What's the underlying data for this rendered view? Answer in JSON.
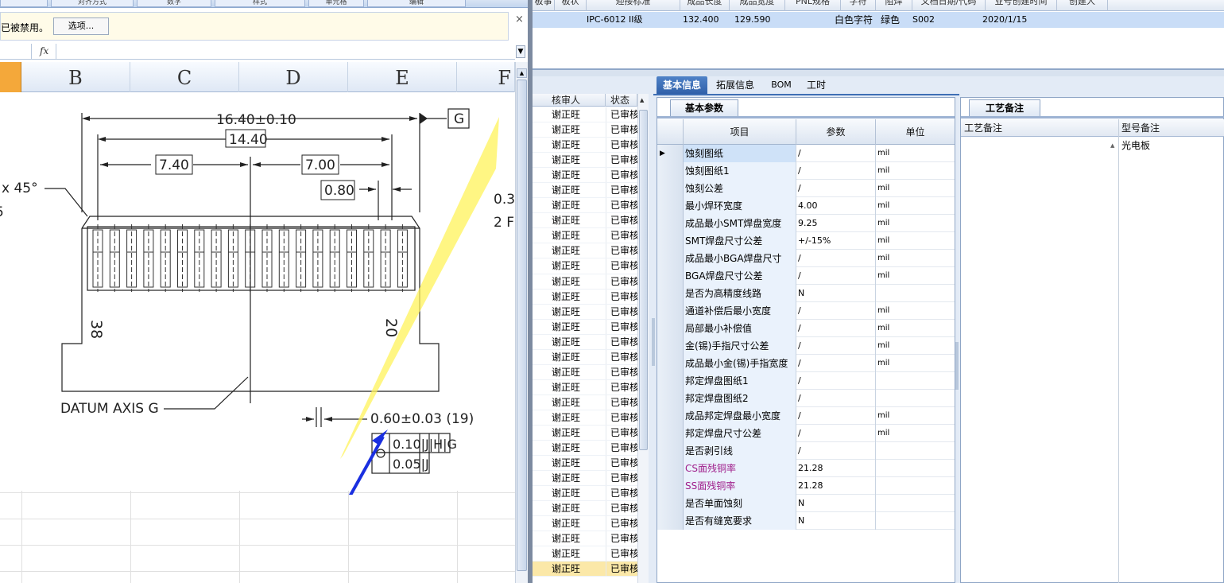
{
  "excel": {
    "ribbon_buttons": [
      "",
      "对齐方式",
      "数字",
      "样式",
      "单元格",
      "编辑"
    ],
    "message_text": "已被禁用。",
    "options_button": "选项...",
    "close_glyph": "×",
    "fx_label": "fx",
    "columns": [
      "B",
      "C",
      "D",
      "E",
      "F"
    ],
    "drawing": {
      "dim_overall": "16.40±0.10",
      "dim_inner": "14.40",
      "dim_left": "7.40",
      "dim_right": "7.00",
      "dim_pitch": "0.80",
      "datum_box": "G",
      "chamfer": "x 45°",
      "chamfer_note": "5",
      "pin_left": "38",
      "pin_right": "20",
      "datum_label": "DATUM AXIS G",
      "pin_width": "0.60±0.03 (19)",
      "tol_row1": "0.10|J|H|G",
      "tol_row2": "0.05|J",
      "side_note1": "0.3",
      "side_note2": "2 F"
    }
  },
  "erp": {
    "top_headers": [
      "板事",
      "板状",
      "迎接标准",
      "成品长度",
      "成品宽度",
      "PNL规格",
      "字符",
      "阻焊",
      "文档日期/代码",
      "业号创建时间",
      "创建人"
    ],
    "top_row": {
      "standard": "IPC-6012 II级",
      "length": "132.400",
      "width": "129.590",
      "silk": "白色字符",
      "mask": "绿色",
      "code": "S002",
      "date": "2020/1/15"
    },
    "list": {
      "headers": [
        "核审人",
        "状态"
      ],
      "reviewer": "谢正旺",
      "status": "已审核",
      "row_count": 31,
      "selected_index": 30
    },
    "tabs": [
      "基本信息",
      "拓展信息",
      "BOM",
      "工时"
    ],
    "param_panel": {
      "title": "基本参数",
      "headers": [
        "项目",
        "参数",
        "单位"
      ],
      "rows": [
        {
          "item": "蚀刻图纸",
          "value": "/",
          "unit": "mil"
        },
        {
          "item": "蚀刻图纸1",
          "value": "/",
          "unit": "mil"
        },
        {
          "item": "蚀刻公差",
          "value": "/",
          "unit": "mil"
        },
        {
          "item": "最小焊环宽度",
          "value": "4.00",
          "unit": "mil"
        },
        {
          "item": "成品最小SMT焊盘宽度",
          "value": "9.25",
          "unit": "mil"
        },
        {
          "item": "SMT焊盘尺寸公差",
          "value": "+/-15%",
          "unit": "mil"
        },
        {
          "item": "成品最小BGA焊盘尺寸",
          "value": "/",
          "unit": "mil"
        },
        {
          "item": "BGA焊盘尺寸公差",
          "value": "/",
          "unit": "mil"
        },
        {
          "item": "是否为高精度线路",
          "value": "N",
          "unit": ""
        },
        {
          "item": "通道补偿后最小宽度",
          "value": "/",
          "unit": "mil"
        },
        {
          "item": "局部最小补偿值",
          "value": "/",
          "unit": "mil"
        },
        {
          "item": "金(锡)手指尺寸公差",
          "value": "/",
          "unit": "mil"
        },
        {
          "item": "成品最小金(锡)手指宽度",
          "value": "/",
          "unit": "mil"
        },
        {
          "item": "邦定焊盘图纸1",
          "value": "/",
          "unit": ""
        },
        {
          "item": "邦定焊盘图纸2",
          "value": "/",
          "unit": ""
        },
        {
          "item": "成品邦定焊盘最小宽度",
          "value": "/",
          "unit": "mil"
        },
        {
          "item": "邦定焊盘尺寸公差",
          "value": "/",
          "unit": "mil"
        },
        {
          "item": "是否剥引线",
          "value": "/",
          "unit": ""
        },
        {
          "item": "CS面残铜率",
          "value": "21.28",
          "unit": "",
          "pink": true
        },
        {
          "item": "SS面残铜率",
          "value": "21.28",
          "unit": "",
          "pink": true
        },
        {
          "item": "是否单面蚀刻",
          "value": "N",
          "unit": ""
        },
        {
          "item": "是否有缝宽要求",
          "value": "N",
          "unit": ""
        }
      ]
    },
    "notes_panel": {
      "title": "工艺备注",
      "headers": [
        "工艺备注",
        "型号备注"
      ],
      "model_note": "光电板"
    }
  },
  "colors": {
    "selected_header": "#f4a83a",
    "tab_active": "#2f5fa8",
    "row_highlight": "#c9ddf7",
    "pink_text": "#a0208c"
  }
}
